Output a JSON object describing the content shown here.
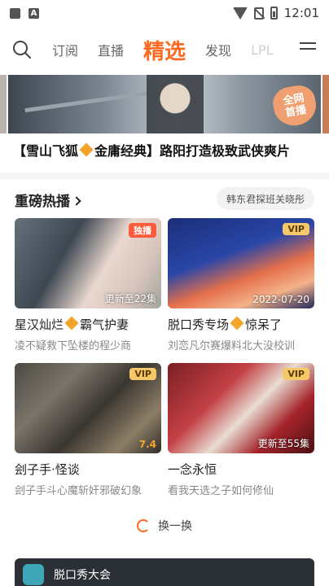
{
  "status_bar": {
    "time": "12:01",
    "icons": [
      "image-icon",
      "a-icon",
      "wifi-icon",
      "no-sim-icon",
      "battery-icon"
    ]
  },
  "nav": {
    "tabs": [
      {
        "label": "订阅"
      },
      {
        "label": "直播"
      },
      {
        "label": "精选",
        "active": true
      },
      {
        "label": "发现"
      },
      {
        "label": "LPL"
      }
    ],
    "accent_color": "#ff6a20"
  },
  "banner": {
    "badge_line1": "全网",
    "badge_line2": "首播",
    "title_part1": "【雪山飞狐",
    "title_part2": "金庸经典】路阳打造极致武侠爽片"
  },
  "section": {
    "title": "重磅热播",
    "tag": "韩东君探班关晓彤"
  },
  "cards": [
    {
      "badge": "独播",
      "corner": "更新至22集",
      "title_part1": "星汉灿烂",
      "title_part2": "霸气护妻",
      "subtitle": "凌不疑救下坠楼的程少商"
    },
    {
      "badge": "VIP",
      "corner": "2022-07-20",
      "title_part1": "脱口秀专场",
      "title_part2": "惊呆了",
      "subtitle": "刘恋凡尔赛爆料北大没校训"
    },
    {
      "badge": "VIP",
      "corner": "7.4",
      "title_part1": "刽子手·怪谈",
      "title_part2": "",
      "subtitle": "刽子手斗心魔斩奸邪破幻象"
    },
    {
      "badge": "VIP",
      "corner": "更新至55集",
      "title_part1": "一念永恒",
      "title_part2": "",
      "subtitle": "看我天选之子如何修仙"
    }
  ],
  "shuffle": {
    "label": "换一换"
  },
  "bottom_strip": {
    "label": "脱口秀大会"
  }
}
